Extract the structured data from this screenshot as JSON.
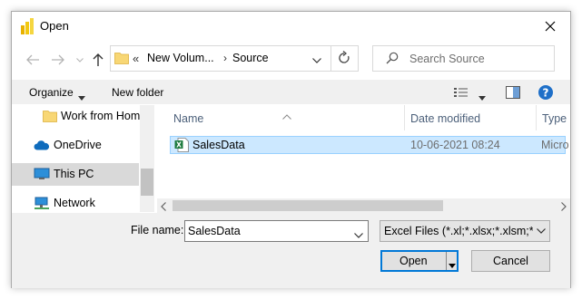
{
  "window": {
    "title": "Open",
    "icon": "power-bi-icon"
  },
  "address": {
    "overflow_glyph": "«",
    "segments": [
      "New Volum...",
      "Source"
    ],
    "separator": "›"
  },
  "search": {
    "placeholder": "Search Source"
  },
  "toolbar": {
    "organize_label": "Organize",
    "new_folder_label": "New folder"
  },
  "nav": {
    "items": [
      {
        "label": "Work from Hom",
        "icon": "folder-icon",
        "selected": false
      },
      {
        "label": "OneDrive",
        "icon": "onedrive-cloud-icon",
        "selected": false
      },
      {
        "label": "This PC",
        "icon": "computer-icon",
        "selected": true
      },
      {
        "label": "Network",
        "icon": "network-icon",
        "selected": false
      }
    ]
  },
  "files": {
    "columns": [
      "Name",
      "Date modified",
      "Type"
    ],
    "rows": [
      {
        "name": "SalesData",
        "date_modified": "10-06-2021 08:24",
        "type": "Micro",
        "icon": "excel-file-icon",
        "selected": true
      }
    ]
  },
  "bottom": {
    "file_name_label": "File name:",
    "file_name_value": "SalesData",
    "filter_value": "Excel Files (*.xl;*.xlsx;*.xlsm;*.xl",
    "open_label": "Open",
    "cancel_label": "Cancel"
  },
  "colors": {
    "accent": "#0078d7",
    "selection": "#cce8ff",
    "help": "#1e6fc8"
  }
}
